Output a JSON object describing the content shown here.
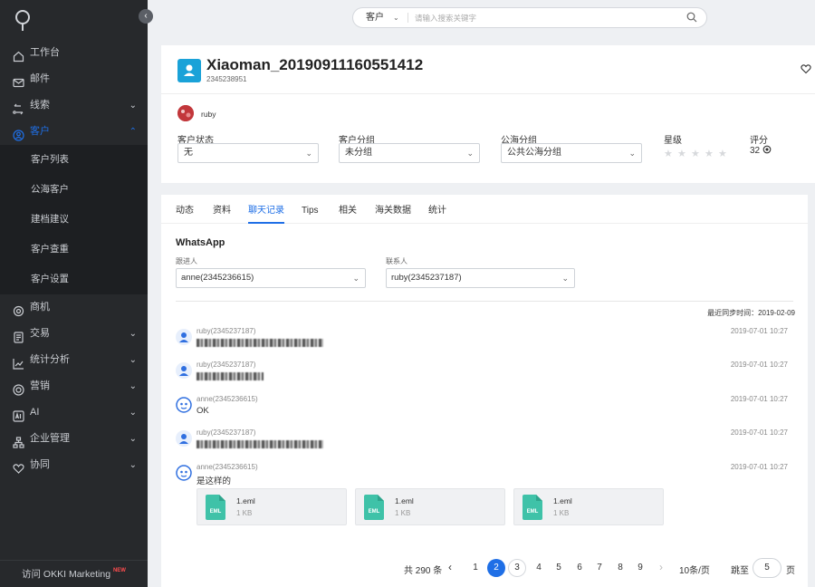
{
  "sidebar": {
    "items": [
      {
        "label": "工作台",
        "icon": "home-icon"
      },
      {
        "label": "邮件",
        "icon": "mail-icon"
      },
      {
        "label": "线索",
        "icon": "clue-icon"
      },
      {
        "label": "客户",
        "icon": "customer-icon"
      },
      {
        "label": "商机",
        "icon": "opportunity-icon"
      },
      {
        "label": "交易",
        "icon": "trade-icon"
      },
      {
        "label": "统计分析",
        "icon": "chart-icon"
      },
      {
        "label": "营销",
        "icon": "marketing-icon"
      },
      {
        "label": "AI",
        "icon": "ai-icon"
      },
      {
        "label": "企业管理",
        "icon": "org-icon"
      },
      {
        "label": "协同",
        "icon": "collab-icon"
      }
    ],
    "submenu": [
      "客户列表",
      "公海客户",
      "建档建议",
      "客户查重",
      "客户设置"
    ],
    "footer": "访问 OKKI Marketing",
    "footer_badge": "NEW",
    "active_color": "#1f6fe6"
  },
  "search": {
    "category": "客户",
    "placeholder": "请输入搜索关键字"
  },
  "customer": {
    "name": "Xiaoman_20190911160551412",
    "id": "2345238951",
    "owner": "ruby",
    "avatar_color": "#1aa2d8",
    "fields": [
      {
        "label": "客户状态",
        "value": "无"
      },
      {
        "label": "客户分组",
        "value": "未分组"
      },
      {
        "label": "公海分组",
        "value": "公共公海分组"
      }
    ],
    "rating_label": "星级",
    "rating_stars": 0,
    "rating_max": 5,
    "score_label": "评分",
    "score_value": "32"
  },
  "tabs": [
    "动态",
    "资料",
    "聊天记录",
    "Tips",
    "相关",
    "海关数据",
    "统计"
  ],
  "active_tab": "聊天记录",
  "chat": {
    "title": "WhatsApp",
    "follower_label": "跟进人",
    "follower_value": "anne(2345236615)",
    "contact_label": "联系人",
    "contact_value": "ruby(2345237187)",
    "sync_text": "最近同步时间：2019-02-09",
    "messages": [
      {
        "sender": "ruby(2345237187)",
        "time": "2019-07-01 10:27",
        "text": ""
      },
      {
        "sender": "ruby(2345237187)",
        "time": "2019-07-01 10:27",
        "text": ""
      },
      {
        "sender": "anne(2345236615)",
        "time": "2019-07-01 10:27",
        "text": "OK"
      },
      {
        "sender": "ruby(2345237187)",
        "time": "2019-07-01 10:27",
        "text": ""
      },
      {
        "sender": "anne(2345236615)",
        "time": "2019-07-01 10:27",
        "text": "是这样的"
      }
    ],
    "attachments": [
      {
        "name": "1.eml",
        "size": "1 KB",
        "badge": "EML"
      },
      {
        "name": "1.eml",
        "size": "1 KB",
        "badge": "EML"
      },
      {
        "name": "1.eml",
        "size": "1 KB",
        "badge": "EML"
      }
    ]
  },
  "pagination": {
    "total": "共 290 条",
    "pages": [
      "1",
      "2",
      "3",
      "4",
      "5",
      "6",
      "7",
      "8",
      "9"
    ],
    "current": "2",
    "page_size": "10条/页",
    "goto_label": "跳至",
    "goto_value": "5",
    "page_unit": "页"
  }
}
